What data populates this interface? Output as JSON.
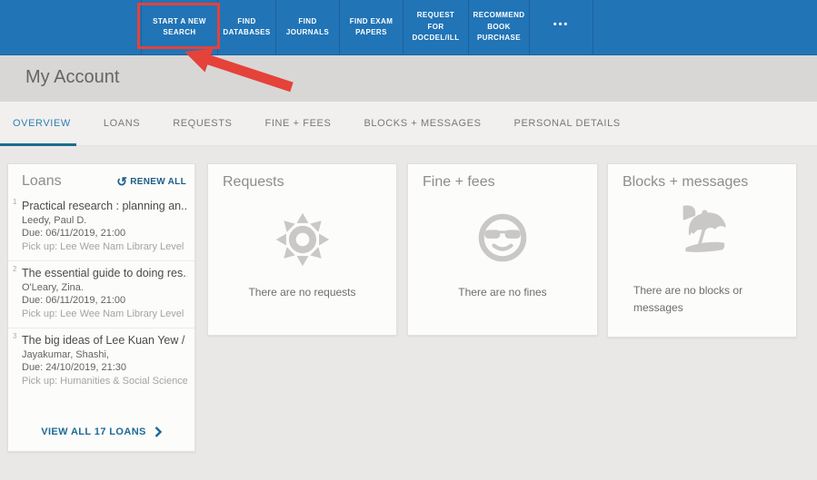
{
  "nav": {
    "items": [
      {
        "label": "START A NEW SEARCH"
      },
      {
        "label": "FIND DATABASES"
      },
      {
        "label": "FIND JOURNALS"
      },
      {
        "label": "FIND EXAM PAPERS"
      },
      {
        "label": "REQUEST FOR DOCDEL/ILL"
      },
      {
        "label": "RECOMMEND BOOK PURCHASE"
      },
      {
        "label": "•••"
      }
    ]
  },
  "header": {
    "title": "My Account"
  },
  "tabs": [
    {
      "label": "OVERVIEW",
      "active": true
    },
    {
      "label": "LOANS"
    },
    {
      "label": "REQUESTS"
    },
    {
      "label": "FINE + FEES"
    },
    {
      "label": "BLOCKS + MESSAGES"
    },
    {
      "label": "PERSONAL DETAILS"
    }
  ],
  "loans": {
    "title": "Loans",
    "renew_all": "RENEW ALL",
    "items": [
      {
        "num": "1",
        "title": "Practical research : planning an...",
        "author": "Leedy, Paul D.",
        "due": "Due: 06/11/2019, 21:00",
        "pickup": "Pick up: Lee Wee Nam Library Level ..."
      },
      {
        "num": "2",
        "title": "The essential guide to doing res...",
        "author": "O'Leary, Zina.",
        "due": "Due: 06/11/2019, 21:00",
        "pickup": "Pick up: Lee Wee Nam Library Level ..."
      },
      {
        "num": "3",
        "title": "The big ideas of Lee Kuan Yew /",
        "author": "Jayakumar, Shashi,",
        "due": "Due: 24/10/2019, 21:30",
        "pickup": "Pick up: Humanities & Social Science..."
      }
    ],
    "view_all": "VIEW ALL 17 LOANS"
  },
  "requests": {
    "title": "Requests",
    "empty": "There are no requests",
    "icon": "sun-icon"
  },
  "fines": {
    "title": "Fine + fees",
    "empty": "There are no fines",
    "icon": "sunglasses-face-icon"
  },
  "blocks": {
    "title": "Blocks + messages",
    "empty": "There are no blocks or messages",
    "icon": "beach-umbrella-icon"
  },
  "icons": {
    "renew": "↺"
  },
  "annotation": {
    "description": "red box and arrow highlighting Start a new search"
  },
  "colors": {
    "nav_blue": "#2174b6",
    "highlight_red": "#e5423a",
    "link_blue": "#1d6a96",
    "active_tab_underline": "#1e6b8e",
    "band_gray": "#d8d7d6"
  }
}
